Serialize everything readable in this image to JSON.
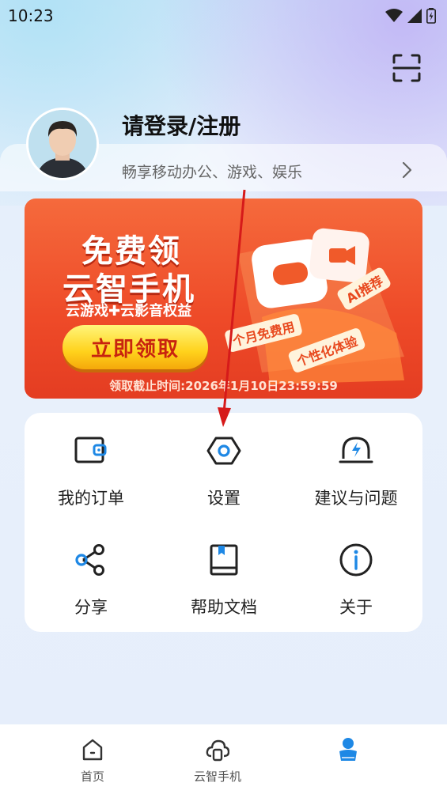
{
  "status_bar": {
    "time": "10:23"
  },
  "profile": {
    "title": "请登录/注册",
    "subtitle": "畅享移动办公、游戏、娱乐"
  },
  "banner": {
    "line1": "免费领",
    "line2": "云智手机",
    "line3": "云游戏✚云影音权益",
    "button_label": "立即领取",
    "deadline": "领取截止时间:2026年1月10日23:59:59",
    "tags": [
      "个月免费用",
      "AI推荐",
      "个性化体验"
    ]
  },
  "menu": {
    "items": [
      {
        "label": "我的订单",
        "icon": "wallet-icon"
      },
      {
        "label": "设置",
        "icon": "settings-hex-icon"
      },
      {
        "label": "建议与问题",
        "icon": "feedback-bell-icon"
      },
      {
        "label": "分享",
        "icon": "share-icon"
      },
      {
        "label": "帮助文档",
        "icon": "book-icon"
      },
      {
        "label": "关于",
        "icon": "info-icon"
      }
    ]
  },
  "tabs": [
    {
      "label": "首页",
      "icon": "home-icon"
    },
    {
      "label": "云智手机",
      "icon": "cloud-phone-icon"
    },
    {
      "label": "",
      "icon": "profile-icon",
      "active": true
    }
  ],
  "colors": {
    "accent": "#1e88e5",
    "banner": "#ee4a28",
    "annotation_arrow": "#d61a1a"
  }
}
